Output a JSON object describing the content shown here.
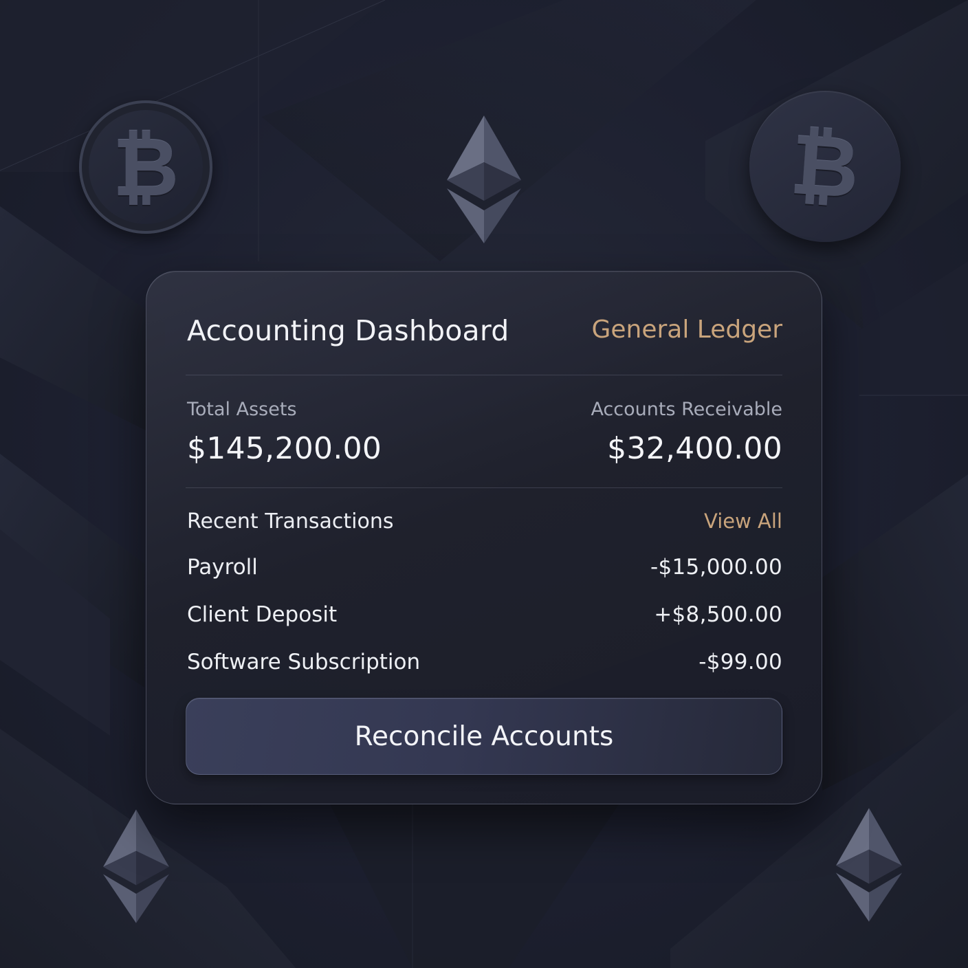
{
  "dashboard": {
    "title": "Accounting Dashboard",
    "ledger_link": "General Ledger"
  },
  "stats": {
    "total_assets": {
      "label": "Total Assets",
      "value": "$145,200.00"
    },
    "accounts_receivable": {
      "label": "Accounts Receivable",
      "value": "$32,400.00"
    }
  },
  "transactions": {
    "heading": "Recent Transactions",
    "view_all_label": "View All",
    "items": [
      {
        "name": "Payroll",
        "amount": "-$15,000.00"
      },
      {
        "name": "Client Deposit",
        "amount": "+$8,500.00"
      },
      {
        "name": "Software Subscription",
        "amount": "-$99.00"
      }
    ]
  },
  "actions": {
    "reconcile_label": "Reconcile Accounts"
  },
  "decorations": {
    "icons": [
      "bitcoin-coin-icon",
      "ethereum-icon"
    ],
    "btc_symbol": "₿"
  },
  "colors": {
    "background": "#1c1f2b",
    "card": "#23263a",
    "accent_gold": "#c9a47c",
    "text_primary": "#f2f3f7",
    "text_secondary": "#a8acba",
    "button": "#363a54"
  }
}
